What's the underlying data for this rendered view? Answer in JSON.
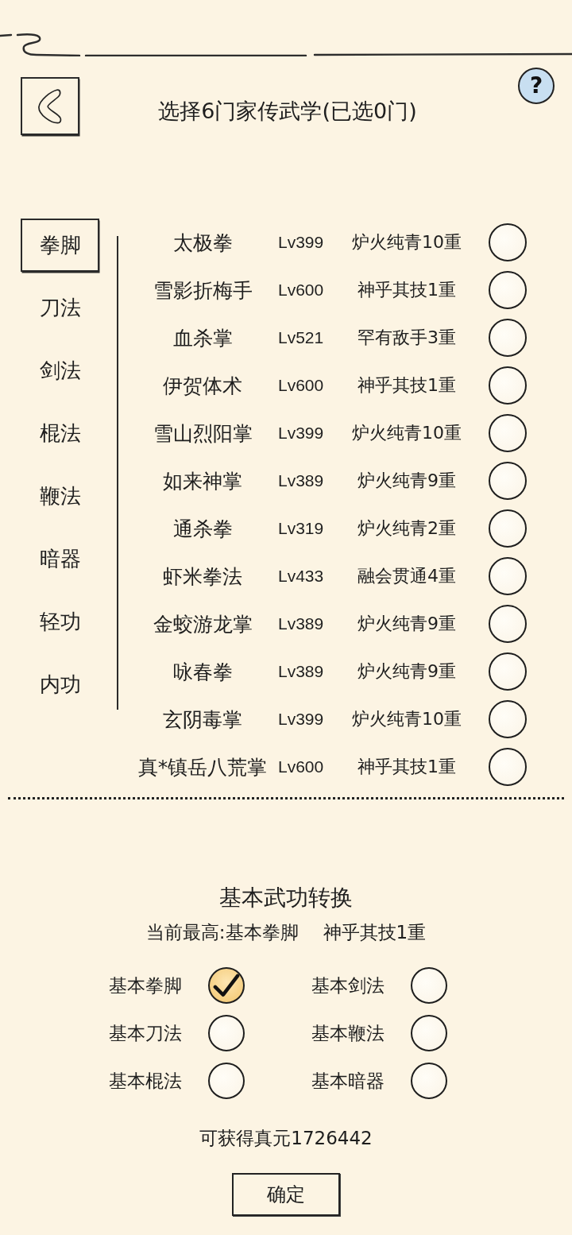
{
  "header": {
    "title": "选择6门家传武学(已选0门)",
    "help_label": "?"
  },
  "categories": [
    {
      "label": "拳脚",
      "selected": true
    },
    {
      "label": "刀法",
      "selected": false
    },
    {
      "label": "剑法",
      "selected": false
    },
    {
      "label": "棍法",
      "selected": false
    },
    {
      "label": "鞭法",
      "selected": false
    },
    {
      "label": "暗器",
      "selected": false
    },
    {
      "label": "轻功",
      "selected": false
    },
    {
      "label": "内功",
      "selected": false
    }
  ],
  "skills": [
    {
      "name": "太极拳",
      "lv": "Lv399",
      "rank": "炉火纯青10重",
      "selected": false
    },
    {
      "name": "雪影折梅手",
      "lv": "Lv600",
      "rank": "神乎其技1重",
      "selected": false
    },
    {
      "name": "血杀掌",
      "lv": "Lv521",
      "rank": "罕有敌手3重",
      "selected": false
    },
    {
      "name": "伊贺体术",
      "lv": "Lv600",
      "rank": "神乎其技1重",
      "selected": false
    },
    {
      "name": "雪山烈阳掌",
      "lv": "Lv399",
      "rank": "炉火纯青10重",
      "selected": false
    },
    {
      "name": "如来神掌",
      "lv": "Lv389",
      "rank": "炉火纯青9重",
      "selected": false
    },
    {
      "name": "通杀拳",
      "lv": "Lv319",
      "rank": "炉火纯青2重",
      "selected": false
    },
    {
      "name": "虾米拳法",
      "lv": "Lv433",
      "rank": "融会贯通4重",
      "selected": false
    },
    {
      "name": "金蛟游龙掌",
      "lv": "Lv389",
      "rank": "炉火纯青9重",
      "selected": false
    },
    {
      "name": "咏春拳",
      "lv": "Lv389",
      "rank": "炉火纯青9重",
      "selected": false
    },
    {
      "name": "玄阴毒掌",
      "lv": "Lv399",
      "rank": "炉火纯青10重",
      "selected": false
    },
    {
      "name": "真*镇岳八荒掌",
      "lv": "Lv600",
      "rank": "神乎其技1重",
      "selected": false
    }
  ],
  "conversion": {
    "title": "基本武功转换",
    "current_label": "当前最高:基本拳脚",
    "current_rank": "神乎其技1重",
    "options": [
      {
        "label": "基本拳脚",
        "checked": true
      },
      {
        "label": "基本剑法",
        "checked": false
      },
      {
        "label": "基本刀法",
        "checked": false
      },
      {
        "label": "基本鞭法",
        "checked": false
      },
      {
        "label": "基本棍法",
        "checked": false
      },
      {
        "label": "基本暗器",
        "checked": false
      }
    ],
    "reward": "可获得真元1726442"
  },
  "confirm_button": "确定"
}
